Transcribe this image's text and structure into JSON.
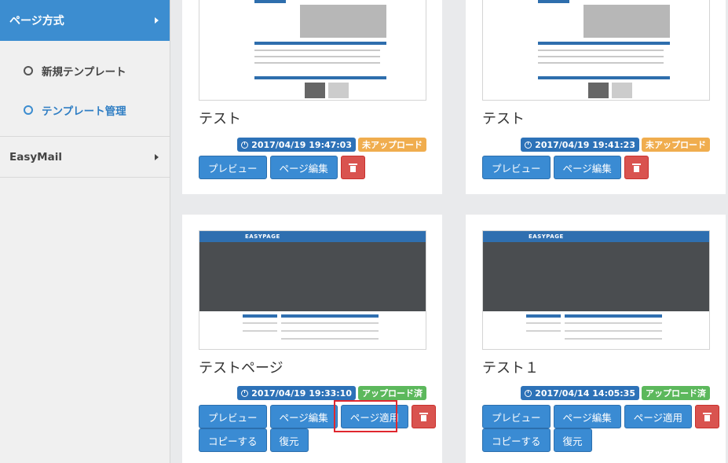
{
  "sidebar": {
    "active_section": "ページ方式",
    "sub_items": [
      {
        "label": "新規テンプレート",
        "active": false
      },
      {
        "label": "テンプレート管理",
        "active": true
      }
    ],
    "other_section": "EasyMail"
  },
  "thumb": {
    "logo_text": "EASYPAGE"
  },
  "cards": [
    {
      "title": "テスト",
      "timestamp": "2017/04/19 19:47:03",
      "status": "未アップロード",
      "buttons": {
        "preview": "プレビュー",
        "edit": "ページ編集"
      }
    },
    {
      "title": "テスト",
      "timestamp": "2017/04/19 19:41:23",
      "status": "未アップロード",
      "buttons": {
        "preview": "プレビュー",
        "edit": "ページ編集"
      }
    },
    {
      "title": "テストページ",
      "timestamp": "2017/04/19 19:33:10",
      "status": "アップロード済",
      "buttons": {
        "preview": "プレビュー",
        "edit": "ページ編集",
        "apply": "ページ適用",
        "copy": "コピーする",
        "restore": "復元"
      }
    },
    {
      "title": "テスト１",
      "timestamp": "2017/04/14 14:05:35",
      "status": "アップロード済",
      "buttons": {
        "preview": "プレビュー",
        "edit": "ページ編集",
        "apply": "ページ適用",
        "copy": "コピーする",
        "restore": "復元"
      }
    }
  ],
  "colors": {
    "primary": "#3a8bd3",
    "timestamp_badge": "#2d72b8",
    "status_not_uploaded": "#f0ad4e",
    "status_uploaded": "#5cb85c",
    "danger": "#d9534f",
    "highlight": "#e0272e"
  },
  "icons": {
    "clock": "clock-icon",
    "trash": "trash-icon",
    "caret": "caret-right-icon"
  }
}
